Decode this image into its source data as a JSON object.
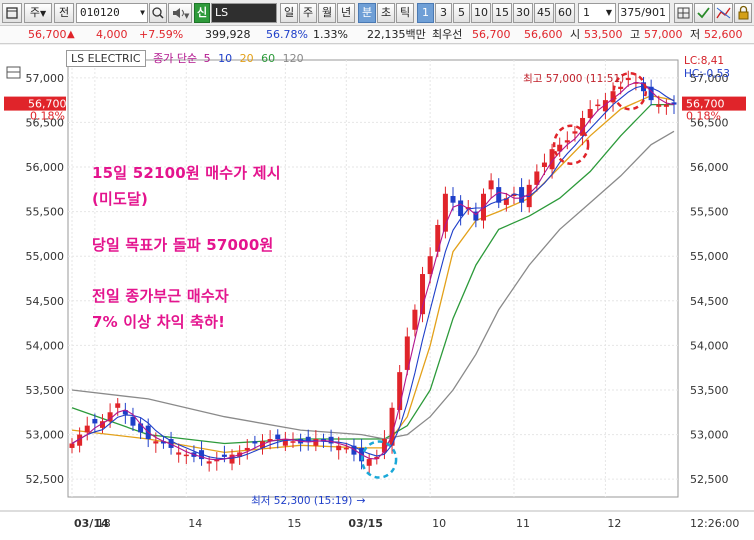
{
  "toolbar": {
    "window_icon": "window-menu-icon",
    "type_select": "주",
    "prev_button": "전",
    "code_value": "010120",
    "search_icon": "search-icon",
    "sound_icon": "speaker-icon",
    "credit_badge": "신",
    "stock_name": "LS ELECTRI",
    "periods": [
      "일",
      "주",
      "월",
      "년",
      "분",
      "초",
      "틱"
    ],
    "active_period": "분",
    "intervals": [
      "1",
      "3",
      "5",
      "10",
      "15",
      "30",
      "45",
      "60"
    ],
    "active_interval": "1",
    "count_value": "1",
    "position_text": "375/901",
    "right_icons": [
      "grid-settings-icon",
      "checkmark-icon",
      "chart-compare-icon",
      "lock-icon"
    ]
  },
  "quote": {
    "price": "56,700",
    "up_arrow": "▲",
    "change": "4,000",
    "change_pct": "+7.59%",
    "volume": "399,928",
    "vol_ratio": "56.78%",
    "turnover": "1.33%",
    "amount": "22,135백만",
    "ask_label": "최우선",
    "ask1": "56,700",
    "ask2": "56,600",
    "open_label": "시",
    "open": "53,500",
    "high_label": "고",
    "high": "57,000",
    "low_label": "저",
    "low": "52,600"
  },
  "legend": {
    "name": "LS ELECTRIC",
    "ma_label": "종가 단순",
    "ma_periods": [
      "5",
      "10",
      "20",
      "60",
      "120"
    ],
    "ma_colors": [
      "#b2158e",
      "#1f3fc9",
      "#e3a11a",
      "#2c9a3a",
      "#8a8a8a"
    ]
  },
  "right_info": {
    "lc": "LC:8,41",
    "hc": "HC:-0,53",
    "price_badge": "56,700",
    "price_pct": "0.18%"
  },
  "left_badge": {
    "price": "56,700",
    "pct": "0.18%"
  },
  "annotations": {
    "high_label": "최고 57,000 (11:51)",
    "low_label": "최저 52,300 (15:19)",
    "low_arrow": "→",
    "time_label": "12:26:00",
    "note_lines": [
      "15일 52100원 매수가 제시",
      "(미도달)",
      "당일 목표가 돌파 57000원",
      "전일 종가부근 매수자",
      "7% 이상 차익 축하!"
    ]
  },
  "chart_data": {
    "type": "line",
    "title": "",
    "ylim": [
      52300,
      57200
    ],
    "y_ticks": [
      "57,000",
      "56,500",
      "56,000",
      "55,500",
      "55,000",
      "54,500",
      "54,000",
      "53,500",
      "53,000",
      "52,500"
    ],
    "y_tick_values": [
      57000,
      56500,
      56000,
      55500,
      55000,
      54500,
      54000,
      53500,
      53000,
      52500
    ],
    "x_labels": [
      "03/14",
      "13",
      "14",
      "15",
      "03/15",
      "10",
      "11",
      "12"
    ],
    "x_bold": [
      true,
      false,
      false,
      false,
      true,
      false,
      false,
      false
    ],
    "grid": true,
    "colors": {
      "candle_up": "#e0242a",
      "candle_down": "#1f3fc9",
      "ma5": "#b2158e",
      "ma10": "#1f3fc9",
      "ma20": "#e3a11a",
      "ma60": "#2c9a3a",
      "ma120": "#8a8a8a",
      "grid": "#e6e6e6",
      "highlight_red": "#e0242a",
      "highlight_cyan": "#1aa8d8"
    },
    "price_points": [
      [
        0,
        52900
      ],
      [
        2,
        53100
      ],
      [
        4,
        53150
      ],
      [
        6,
        53350
      ],
      [
        8,
        53100
      ],
      [
        10,
        52950
      ],
      [
        12,
        52900
      ],
      [
        14,
        52800
      ],
      [
        16,
        52750
      ],
      [
        18,
        52700
      ],
      [
        20,
        52750
      ],
      [
        22,
        52800
      ],
      [
        24,
        52900
      ],
      [
        26,
        52950
      ],
      [
        28,
        52950
      ],
      [
        30,
        52900
      ],
      [
        32,
        52950
      ],
      [
        34,
        52900
      ],
      [
        36,
        52850
      ],
      [
        38,
        52700
      ],
      [
        40,
        52750
      ],
      [
        41,
        52950
      ],
      [
        42,
        53300
      ],
      [
        43,
        53700
      ],
      [
        44,
        54100
      ],
      [
        45,
        54400
      ],
      [
        46,
        54800
      ],
      [
        47,
        55000
      ],
      [
        48,
        55350
      ],
      [
        49,
        55700
      ],
      [
        50,
        55600
      ],
      [
        51,
        55450
      ],
      [
        52,
        55550
      ],
      [
        53,
        55400
      ],
      [
        54,
        55700
      ],
      [
        55,
        55850
      ],
      [
        56,
        55600
      ],
      [
        57,
        55650
      ],
      [
        58,
        55700
      ],
      [
        59,
        55600
      ],
      [
        60,
        55800
      ],
      [
        61,
        55950
      ],
      [
        62,
        56050
      ],
      [
        63,
        56200
      ],
      [
        64,
        56250
      ],
      [
        65,
        56300
      ],
      [
        66,
        56400
      ],
      [
        67,
        56550
      ],
      [
        68,
        56650
      ],
      [
        69,
        56700
      ],
      [
        70,
        56750
      ],
      [
        71,
        56850
      ],
      [
        72,
        56900
      ],
      [
        73,
        57000
      ],
      [
        74,
        56950
      ],
      [
        75,
        56850
      ],
      [
        76,
        56750
      ],
      [
        77,
        56700
      ],
      [
        78,
        56700
      ],
      [
        79,
        56700
      ]
    ],
    "ma_series": [
      {
        "name": "20",
        "points": [
          [
            0,
            53050
          ],
          [
            10,
            52950
          ],
          [
            20,
            52800
          ],
          [
            30,
            52880
          ],
          [
            38,
            52850
          ],
          [
            41,
            52850
          ],
          [
            44,
            53200
          ],
          [
            47,
            54000
          ],
          [
            50,
            55050
          ],
          [
            53,
            55400
          ],
          [
            56,
            55500
          ],
          [
            60,
            55650
          ],
          [
            64,
            56000
          ],
          [
            68,
            56350
          ],
          [
            72,
            56650
          ],
          [
            76,
            56800
          ],
          [
            79,
            56750
          ]
        ]
      },
      {
        "name": "60",
        "points": [
          [
            0,
            53300
          ],
          [
            10,
            53000
          ],
          [
            20,
            52900
          ],
          [
            30,
            52950
          ],
          [
            38,
            52950
          ],
          [
            41,
            52950
          ],
          [
            44,
            53100
          ],
          [
            47,
            53500
          ],
          [
            50,
            54300
          ],
          [
            53,
            54900
          ],
          [
            56,
            55300
          ],
          [
            60,
            55450
          ],
          [
            64,
            55650
          ],
          [
            68,
            55950
          ],
          [
            72,
            56350
          ],
          [
            76,
            56700
          ],
          [
            79,
            56700
          ]
        ]
      },
      {
        "name": "120",
        "points": [
          [
            0,
            53500
          ],
          [
            10,
            53400
          ],
          [
            20,
            53200
          ],
          [
            30,
            53050
          ],
          [
            38,
            53000
          ],
          [
            41,
            52950
          ],
          [
            44,
            53000
          ],
          [
            47,
            53200
          ],
          [
            50,
            53500
          ],
          [
            53,
            53900
          ],
          [
            56,
            54400
          ],
          [
            60,
            54900
          ],
          [
            64,
            55300
          ],
          [
            68,
            55600
          ],
          [
            72,
            55900
          ],
          [
            76,
            56250
          ],
          [
            79,
            56400
          ]
        ]
      }
    ]
  }
}
